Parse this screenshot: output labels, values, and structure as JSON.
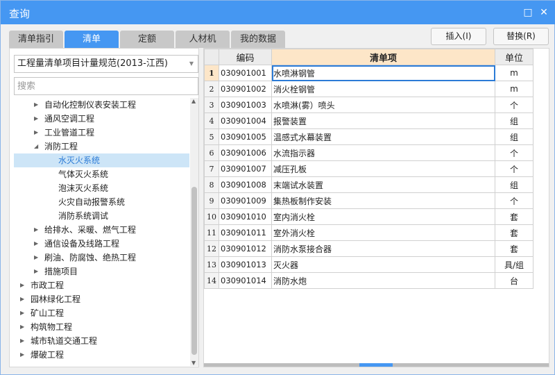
{
  "window": {
    "title": "查询",
    "maximize_icon": "□",
    "close_icon": "✕"
  },
  "tabs": [
    {
      "label": "清单指引"
    },
    {
      "label": "清单",
      "active": true
    },
    {
      "label": "定额"
    },
    {
      "label": "人材机"
    },
    {
      "label": "我的数据"
    }
  ],
  "buttons": {
    "insert": "插入(I)",
    "replace": "替换(R)"
  },
  "left": {
    "standard": "工程量清单项目计量规范(2013-江西)",
    "search_placeholder": "搜索",
    "tree": [
      {
        "label": "自动化控制仪表安装工程",
        "level": 1,
        "state": "collapsed"
      },
      {
        "label": "通风空调工程",
        "level": 1,
        "state": "collapsed"
      },
      {
        "label": "工业管道工程",
        "level": 1,
        "state": "collapsed"
      },
      {
        "label": "消防工程",
        "level": 1,
        "state": "expanded"
      },
      {
        "label": "水灭火系统",
        "level": 2,
        "selected": true
      },
      {
        "label": "气体灭火系统",
        "level": 2
      },
      {
        "label": "泡沫灭火系统",
        "level": 2
      },
      {
        "label": "火灾自动报警系统",
        "level": 2
      },
      {
        "label": "消防系统调试",
        "level": 2
      },
      {
        "label": "给排水、采暖、燃气工程",
        "level": 1,
        "state": "collapsed"
      },
      {
        "label": "通信设备及线路工程",
        "level": 1,
        "state": "collapsed"
      },
      {
        "label": "刷油、防腐蚀、绝热工程",
        "level": 1,
        "state": "collapsed"
      },
      {
        "label": "措施项目",
        "level": 1,
        "state": "collapsed"
      },
      {
        "label": "市政工程",
        "level": 0,
        "state": "collapsed"
      },
      {
        "label": "园林绿化工程",
        "level": 0,
        "state": "collapsed"
      },
      {
        "label": "矿山工程",
        "level": 0,
        "state": "collapsed"
      },
      {
        "label": "构筑物工程",
        "level": 0,
        "state": "collapsed"
      },
      {
        "label": "城市轨道交通工程",
        "level": 0,
        "state": "collapsed"
      },
      {
        "label": "爆破工程",
        "level": 0,
        "state": "collapsed"
      }
    ]
  },
  "grid": {
    "headers": [
      "",
      "编码",
      "清单项",
      "单位"
    ],
    "rows": [
      [
        "1",
        "030901001",
        "水喷淋钢管",
        "m"
      ],
      [
        "2",
        "030901002",
        "消火栓钢管",
        "m"
      ],
      [
        "3",
        "030901003",
        "水喷淋(雾）喷头",
        "个"
      ],
      [
        "4",
        "030901004",
        "报警装置",
        "组"
      ],
      [
        "5",
        "030901005",
        "温感式水幕装置",
        "组"
      ],
      [
        "6",
        "030901006",
        "水流指示器",
        "个"
      ],
      [
        "7",
        "030901007",
        "减压孔板",
        "个"
      ],
      [
        "8",
        "030901008",
        "末端试水装置",
        "组"
      ],
      [
        "9",
        "030901009",
        "集热板制作安装",
        "个"
      ],
      [
        "10",
        "030901010",
        "室内消火栓",
        "套"
      ],
      [
        "11",
        "030901011",
        "室外消火栓",
        "套"
      ],
      [
        "12",
        "030901012",
        "消防水泵接合器",
        "套"
      ],
      [
        "13",
        "030901013",
        "灭火器",
        "具/组"
      ],
      [
        "14",
        "030901014",
        "消防水炮",
        "台"
      ]
    ]
  },
  "colors": {
    "accent": "#4597f2",
    "header_highlight": "#fde6c8",
    "selected_tree": "#cde5f7"
  }
}
